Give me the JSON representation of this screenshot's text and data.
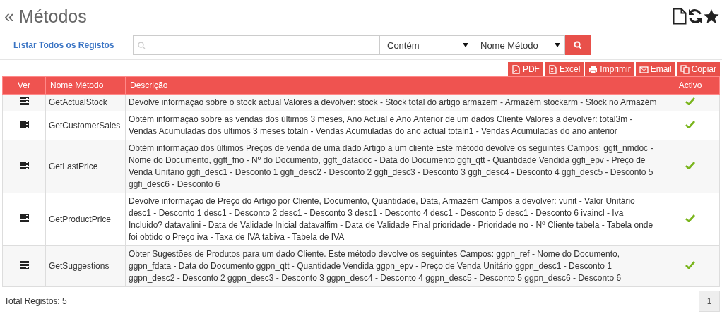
{
  "page_title": "« Métodos",
  "filter": {
    "list_all_link": "Listar Todos os Registos",
    "operator": "Contém",
    "field": "Nome Método"
  },
  "export_buttons": [
    "PDF",
    "Excel",
    "Imprimir",
    "Email",
    "Copiar"
  ],
  "table": {
    "columns": [
      "Ver",
      "Nome Método",
      "Descrição",
      "Activo"
    ],
    "rows": [
      {
        "name": "GetActualStock",
        "description": "Devolve informação sobre o stock actual Valores a devolver: stock - Stock total do artigo armazem - Armazém stockarm - Stock no Armazém",
        "active": true
      },
      {
        "name": "GetCustomerSales",
        "description": "Obtém informação sobre as vendas dos últimos 3 meses, Ano Actual e Ano Anterior de um dados Cliente Valores a devolver: total3m - Vendas Acumuladas dos ultimos 3 meses totaln - Vendas Acumuladas do ano actual totaln1 - Vendas Acumuladas do ano anterior",
        "active": true
      },
      {
        "name": "GetLastPrice",
        "description": "Obtém informação dos últimos Preços de venda de uma dado Artigo a um cliente Este método devolve os seguintes Campos: ggft_nmdoc - Nome do Documento, ggft_fno - Nº do Documento, ggft_datadoc - Data do Documento ggfi_qtt - Quantidade Vendida ggfi_epv - Preço de Venda Unitário ggfi_desc1 - Desconto 1 ggfi_desc2 - Desconto 2 ggfi_desc3 - Desconto 3 ggfi_desc4 - Desconto 4 ggfi_desc5 - Desconto 5 ggfi_desc6 - Desconto 6",
        "active": true
      },
      {
        "name": "GetProductPrice",
        "description": "Devolve informação de Preço do Artigo por Cliente, Documento, Quantidade, Data, Armazém Campos a devolver: vunit - Valor Unitário desc1 - Desconto 1 desc1 - Desconto 2 desc1 - Desconto 3 desc1 - Desconto 4 desc1 - Desconto 5 desc1 - Desconto 6 ivaincl - Iva Incluido? datavalini - Data de Validade Inicial datavalfim - Data de Validade Final prioridade - Prioridade no - Nº Cliente tabela - Tabela onde foi obtido o Preço iva - Taxa de IVA tabiva - Tabela de IVA",
        "active": true
      },
      {
        "name": "GetSuggestions",
        "description": "Obter Sugestões de Produtos para um dado Cliente. Este método devolve os seguintes Campos: ggpn_ref - Nome do Documento, ggpn_fdata - Data do Documento ggpn_qtt - Quantidade Vendida ggpn_epv - Preço de Venda Unitário ggpn_desc1 - Desconto 1 ggpn_desc2 - Desconto 2 ggpn_desc3 - Desconto 3 ggpn_desc4 - Desconto 4 ggpn_desc5 - Desconto 5 ggpn_desc6 - Desconto 6",
        "active": true
      }
    ]
  },
  "footer": {
    "total": "Total Registos: 5",
    "pages": [
      {
        "label": "1",
        "selected": true
      }
    ]
  }
}
